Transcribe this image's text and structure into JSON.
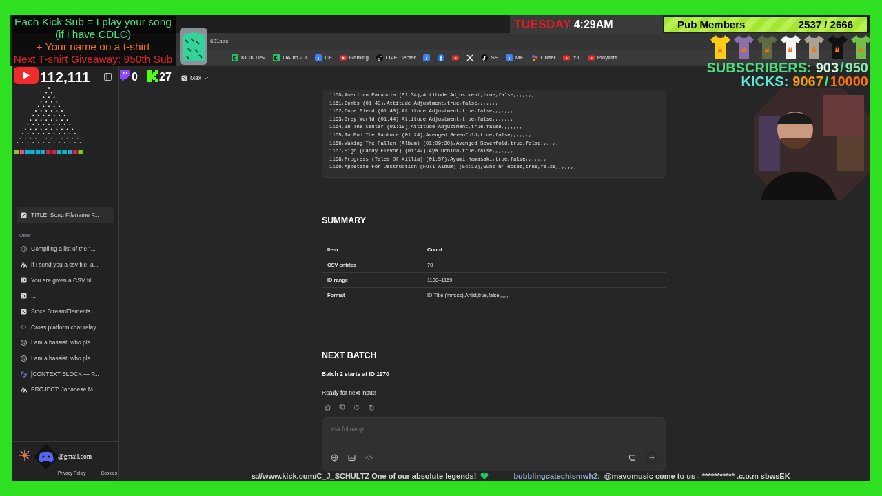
{
  "overlay": {
    "promo_lines": [
      {
        "text": "Each Kick Sub = I play your song",
        "color": "#4ade80"
      },
      {
        "text": "(if i have CDLC)",
        "color": "#4ade80"
      },
      {
        "text": "+ Your name on a t-shirt",
        "color": "#f97316"
      },
      {
        "text": "Next T-shirt Giveaway: 950th Sub",
        "color": "#dc2626"
      }
    ],
    "youtube_count": "112,111",
    "twitch_count": "0",
    "kick_count": "27",
    "day": "TUESDAY",
    "time": "4:29AM",
    "pub_members": {
      "label": "Pub Members",
      "count": "2537 / 2666"
    },
    "shirts": [
      {
        "color": "#facc15"
      },
      {
        "color": "#8b6fa8"
      },
      {
        "color": "#5f6b45"
      },
      {
        "color": "#f5f5f5"
      },
      {
        "color": "#a8a291"
      },
      {
        "color": "#111111"
      },
      {
        "color": "#6fbf4a"
      }
    ],
    "subscribers": {
      "label": "SUBSCRIBERS:",
      "value": "903",
      "separator": "/",
      "goal": "950"
    },
    "kicks": {
      "label": "KICKS:",
      "value": "9067",
      "separator": "/",
      "goal": "10000"
    },
    "ticker": [
      {
        "text": "s://www.kick.com/C_J_SCHULTZ One of our absolute legends!",
        "color": "#d4d4d4"
      },
      {
        "text": "bubblingcatechismwh2:",
        "color": "#93a8d6"
      },
      {
        "text": "@mavomusic come to us - *********** .c.o.m sbwsEK",
        "color": "#d4d4d4"
      }
    ]
  },
  "browser": {
    "address": "601aac",
    "bookmarks": [
      {
        "label": "KICK Dev",
        "kind": "kick"
      },
      {
        "label": "OAuth 2.1",
        "kind": "kick"
      },
      {
        "label": "CF",
        "kind": "info"
      },
      {
        "label": "Gaming",
        "kind": "youtube"
      },
      {
        "label": "LIVE Center",
        "kind": "note"
      },
      {
        "kind": "info"
      },
      {
        "kind": "facebook"
      },
      {
        "kind": "youtube"
      },
      {
        "kind": "x"
      },
      {
        "label": "SS",
        "kind": "note"
      },
      {
        "label": "MF",
        "kind": "info"
      },
      {
        "label": "Cutter",
        "kind": "dots"
      },
      {
        "label": "YT",
        "kind": "youtube"
      },
      {
        "label": "Playlists",
        "kind": "youtube"
      }
    ]
  },
  "model_selector": "Max",
  "sidebar": {
    "recent": [
      {
        "label": "TITLE: Song Filename F...",
        "kind": "box",
        "selected": true
      }
    ],
    "older_heading": "Older",
    "older": [
      {
        "label": "Compiling a list of the \"...",
        "kind": "globe",
        "selected": false
      },
      {
        "label": "If i send you a csv file, a...",
        "kind": "peak",
        "selected": false
      },
      {
        "label": "You are given a CSV fil...",
        "kind": "box",
        "selected": false
      },
      {
        "label": "...",
        "kind": "box",
        "selected": false
      },
      {
        "label": "Since StreamElements ...",
        "kind": "box",
        "selected": false
      },
      {
        "label": "Cross platform chat relay",
        "kind": "code",
        "selected": false
      },
      {
        "label": "I am a bassist, who pla...",
        "kind": "swirl",
        "selected": false
      },
      {
        "label": "I am a bassist, who pla...",
        "kind": "swirl",
        "selected": false
      },
      {
        "label": "[CONTEXT BLOCK — P...",
        "kind": "ring",
        "selected": false
      },
      {
        "label": "PROJECT: Japanese M...",
        "kind": "peak",
        "selected": false
      }
    ],
    "account_email": "@gmail.com",
    "footer_links": [
      "Privacy Policy",
      "Cookies"
    ]
  },
  "chat": {
    "code_lines": [
      "1160,American Paranoia (01:34),Attitude Adjustment,true,false,,,,,,,",
      "1161,Bombs (01:43),Attitude Adjustment,true,false,,,,,,,",
      "1162,Dope Fiend (01:40),Attitude Adjustment,true,false,,,,,,,",
      "1163,Grey World (01:44),Attitude Adjustment,true,false,,,,,,,",
      "1164,In The Center (01:15),Attitude Adjustment,true,false,,,,,,,",
      "1165,To End The Rapture (01:24),Avenged Sevenfold,true,false,,,,,,,",
      "1166,Waking The Fallen (Album) (01:09:30),Avenged Sevenfold,true,false,,,,,,,",
      "1167,Sign (Candy Flavor) (01:42),Aya Uchida,true,false,,,,,,,",
      "1168,Progress (Tales Of Xillia) (01:57),Ayumi Hamasaki,true,false,,,,,,,",
      "1169,Appetite For Destruction (Full Album) (54:12),Guns N' Roses,true,false,,,,,,,"
    ],
    "summary": {
      "heading": "SUMMARY",
      "columns": [
        "Item",
        "Count"
      ],
      "rows": [
        [
          "CSV entries",
          "70"
        ],
        [
          "ID range",
          "1100–1169"
        ],
        [
          "Format",
          "ID,Title (mm:ss),Artist,true,false,,,,,,,"
        ]
      ]
    },
    "next_batch": {
      "heading": "NEXT BATCH",
      "lines": [
        {
          "text": "Batch 2 starts at ID 1170",
          "bold": true
        },
        {
          "text": "Ready for next input!",
          "bold": false
        }
      ]
    },
    "composer": {
      "placeholder": "Ask followup..."
    }
  }
}
